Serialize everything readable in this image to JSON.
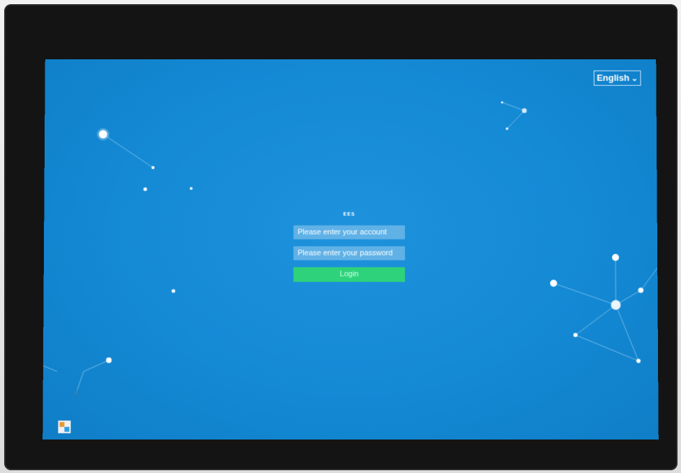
{
  "language_selector": {
    "label": "English",
    "icon": "chevron-down-icon"
  },
  "login": {
    "title": "EES",
    "account_placeholder": "Please enter your account",
    "password_placeholder": "Please enter your password",
    "login_label": "Login"
  },
  "colors": {
    "screen_background": "#1489d4",
    "input_background": "#5fb1e6",
    "login_button": "#2ed27a",
    "bezel": "#141414"
  },
  "corner_logo": {
    "icon": "app-logo-icon"
  }
}
